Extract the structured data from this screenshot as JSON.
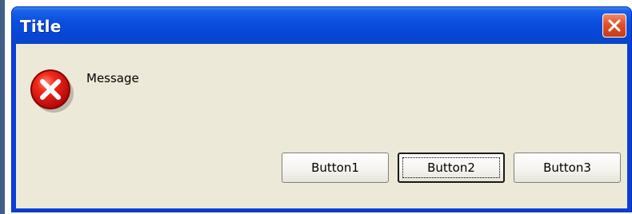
{
  "window": {
    "title": "Title",
    "close_icon": "close-icon",
    "titlebar_color": "#0a4ee0",
    "close_button_color": "#e0502a",
    "client_background": "#ece9d8"
  },
  "dialog": {
    "icon": "error-icon",
    "icon_color": "#e01010",
    "message": "Message"
  },
  "buttons": [
    {
      "label": "Button1",
      "focused": false
    },
    {
      "label": "Button2",
      "focused": true
    },
    {
      "label": "Button3",
      "focused": false
    }
  ]
}
